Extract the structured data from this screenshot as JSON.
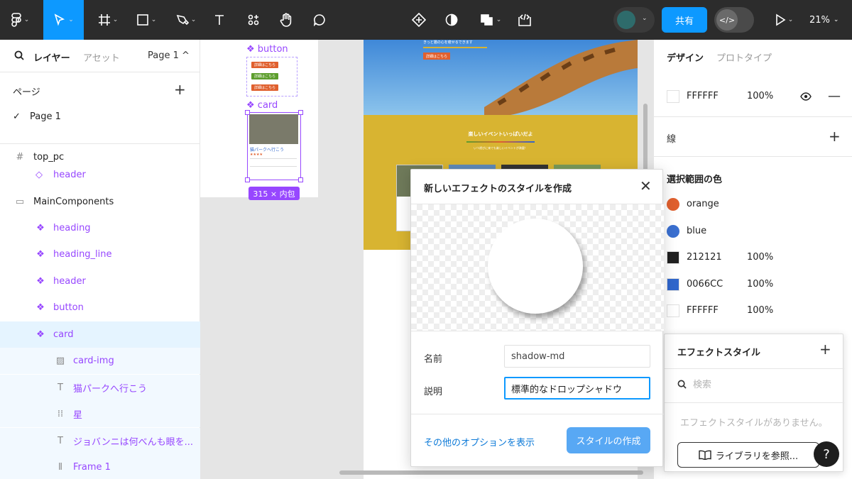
{
  "toolbar": {
    "zoom": "21%",
    "share_label": "共有",
    "dev_mode_icon": "code-icon",
    "icons": [
      "figma-menu-icon",
      "move-tool-icon",
      "frame-tool-icon",
      "shape-tool-icon",
      "pen-tool-icon",
      "text-tool-icon",
      "resources-icon",
      "hand-tool-icon",
      "comment-icon",
      "component-icon",
      "contrast-icon",
      "boolean-icon",
      "code-icon",
      "play-icon"
    ]
  },
  "left_panel": {
    "tabs": {
      "layers": "レイヤー",
      "assets": "アセット",
      "page_selector": "Page 1 ^"
    },
    "pages_heading": "ページ",
    "pages": [
      "Page 1"
    ],
    "layers": [
      {
        "label": "top_pc",
        "icon": "frame-icon"
      },
      {
        "label": "header",
        "icon": "instance-icon"
      },
      {
        "label": "MainComponents",
        "icon": "section-icon"
      },
      {
        "label": "heading",
        "icon": "component-icon"
      },
      {
        "label": "heading_line",
        "icon": "component-icon"
      },
      {
        "label": "header",
        "icon": "component-icon"
      },
      {
        "label": "button",
        "icon": "component-icon"
      },
      {
        "label": "card",
        "icon": "component-icon"
      },
      {
        "label": "card-img",
        "icon": "image-icon"
      },
      {
        "label": "猫パークへ行こう",
        "icon": "text-icon"
      },
      {
        "label": "星",
        "icon": "frame-dashed-icon"
      },
      {
        "label": "ジョバンニは何べんも眼を...",
        "icon": "text-icon"
      },
      {
        "label": "Frame 1",
        "icon": "autolayout-icon"
      }
    ]
  },
  "canvas": {
    "button_component_label": "button",
    "card_component_label": "card",
    "mini_buttons": [
      "詳細はこちら",
      "詳細はこちら",
      "詳細はこちら"
    ],
    "card_title": "猫パークへ行こう",
    "size_badge": "315 × 内包",
    "site_heading": "楽しいイベントいっぱいだよ",
    "site_sub": "いつ遊びに来ても楽しいイベントが満載！",
    "hero_text": "きっと猫の心を癒せるできます",
    "hero_button": "詳細はこちら"
  },
  "dialog": {
    "title": "新しいエフェクトのスタイルを作成",
    "name_label": "名前",
    "name_value": "shadow-md",
    "desc_label": "説明",
    "desc_value": "標準的なドロップシャドウ",
    "more_options": "その他のオプションを表示",
    "create_button": "スタイルの作成"
  },
  "right_panel": {
    "tabs": {
      "design": "デザイン",
      "prototype": "プロトタイプ"
    },
    "fill": {
      "hex": "FFFFFF",
      "opacity": "100%"
    },
    "stroke_label": "線",
    "selection_colors_heading": "選択範囲の色",
    "selection_colors": [
      {
        "name": "orange",
        "color": "#e0602e",
        "round": true
      },
      {
        "name": "blue",
        "color": "#3a6fd0",
        "round": true
      },
      {
        "name": "212121",
        "opacity": "100%",
        "color": "#212121",
        "round": false
      },
      {
        "name": "0066CC",
        "opacity": "100%",
        "color": "#2f66cc",
        "round": false
      },
      {
        "name": "FFFFFF",
        "opacity": "100%",
        "color": "#ffffff",
        "round": false
      }
    ]
  },
  "effect_styles": {
    "title": "エフェクトスタイル",
    "search_placeholder": "検索",
    "empty_text": "エフェクトスタイルがありません。",
    "library_button": "ライブラリを参照...",
    "help": "?"
  }
}
